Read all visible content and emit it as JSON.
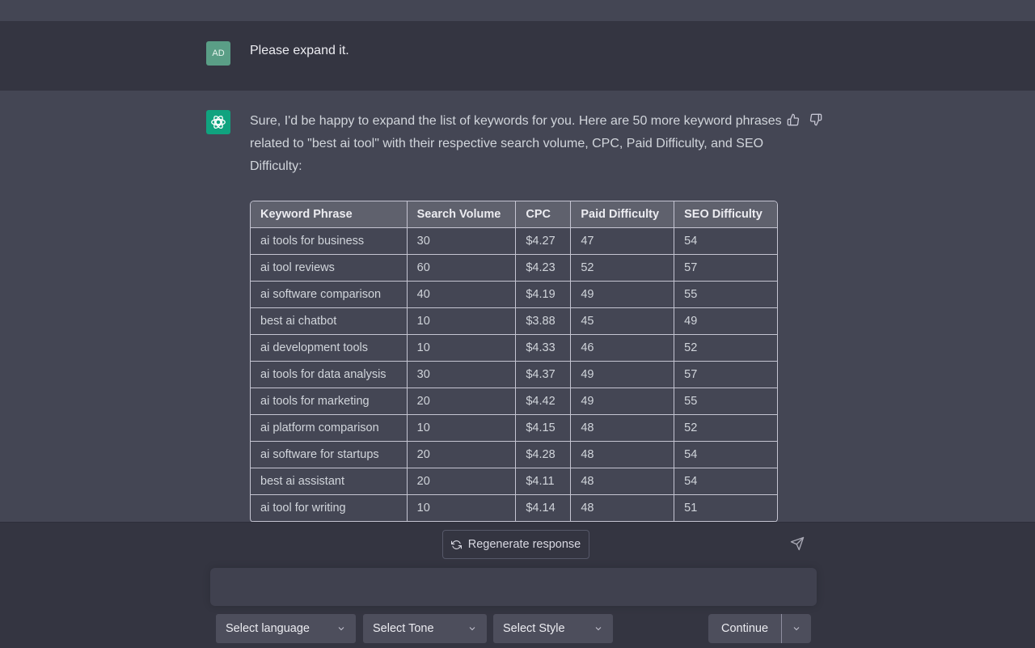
{
  "conversation": {
    "user": {
      "avatar_initials": "AD",
      "message": "Please expand it."
    },
    "assistant": {
      "intro": "Sure, I'd be happy to expand the list of keywords for you. Here are 50 more keyword phrases related to \"best ai tool\" with their respective search volume, CPC, Paid Difficulty, and SEO Difficulty:",
      "table": {
        "headers": [
          "Keyword Phrase",
          "Search Volume",
          "CPC",
          "Paid Difficulty",
          "SEO Difficulty"
        ],
        "rows": [
          [
            "ai tools for business",
            "30",
            "$4.27",
            "47",
            "54"
          ],
          [
            "ai tool reviews",
            "60",
            "$4.23",
            "52",
            "57"
          ],
          [
            "ai software comparison",
            "40",
            "$4.19",
            "49",
            "55"
          ],
          [
            "best ai chatbot",
            "10",
            "$3.88",
            "45",
            "49"
          ],
          [
            "ai development tools",
            "10",
            "$4.33",
            "46",
            "52"
          ],
          [
            "ai tools for data analysis",
            "30",
            "$4.37",
            "49",
            "57"
          ],
          [
            "ai tools for marketing",
            "20",
            "$4.42",
            "49",
            "55"
          ],
          [
            "ai platform comparison",
            "10",
            "$4.15",
            "48",
            "52"
          ],
          [
            "ai software for startups",
            "20",
            "$4.28",
            "48",
            "54"
          ],
          [
            "best ai assistant",
            "20",
            "$4.11",
            "48",
            "54"
          ],
          [
            "ai tool for writing",
            "10",
            "$4.14",
            "48",
            "51"
          ]
        ]
      }
    }
  },
  "composer": {
    "regenerate_label": "Regenerate response",
    "input_value": "",
    "language_select": "Select language",
    "tone_select": "Select Tone",
    "style_select": "Select Style",
    "continue_label": "Continue"
  },
  "icons": {
    "bot": "openai-logo-icon",
    "thumbs_up": "thumbs-up-icon",
    "thumbs_down": "thumbs-down-icon",
    "regenerate": "refresh-icon",
    "send": "paper-plane-icon",
    "dropdown": "chevron-down-icon"
  },
  "colors": {
    "user_bg": "#343541",
    "assistant_bg": "#444654",
    "bot_avatar": "#10a37f",
    "user_avatar": "#5a9e86"
  }
}
